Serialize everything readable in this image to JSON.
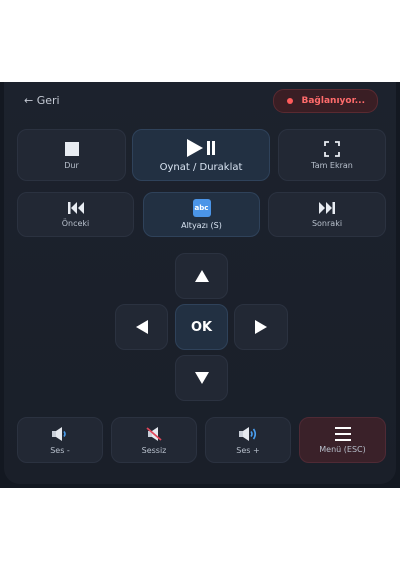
{
  "header": {
    "back_label": "← Geri",
    "status_label": "Bağlanıyor..."
  },
  "controls": {
    "stop": "Dur",
    "play_pause": "Oynat / Duraklat",
    "fullscreen": "Tam Ekran",
    "previous": "Önceki",
    "subtitle": "Altyazı (S)",
    "subtitle_icon_text": "abc",
    "next": "Sonraki"
  },
  "dpad": {
    "ok": "OK"
  },
  "volume": {
    "down": "Ses -",
    "mute": "Sessiz",
    "up": "Ses +",
    "menu": "Menü (ESC)"
  },
  "colors": {
    "accent_status": "#ff6b6b",
    "highlight": "#223042",
    "menu_button": "#3a2129"
  }
}
